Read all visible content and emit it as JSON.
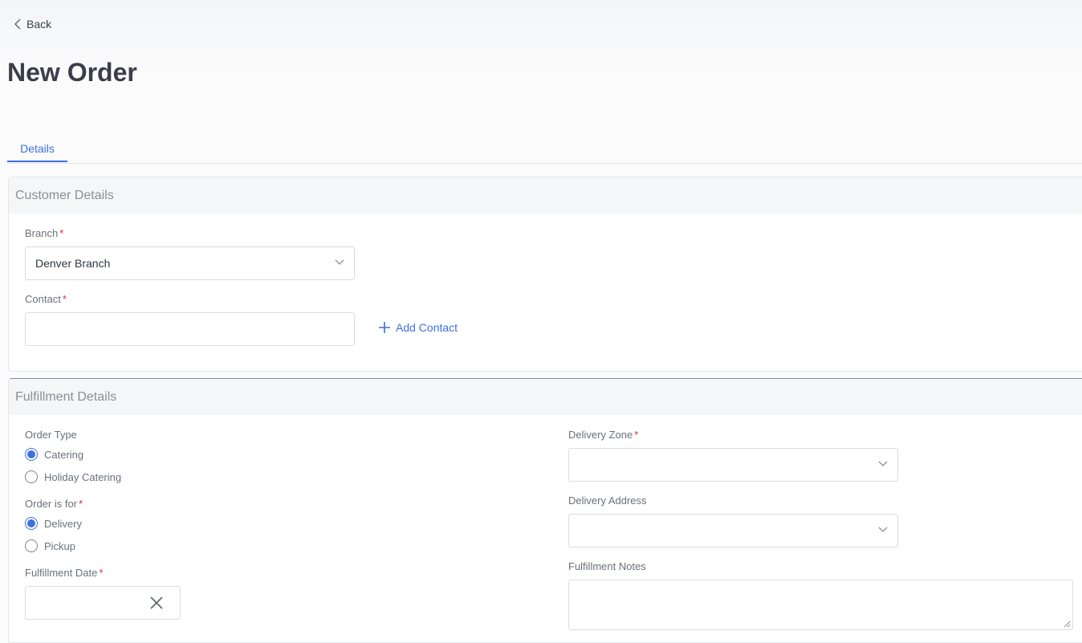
{
  "header": {
    "back_label": "Back",
    "page_title": "New Order"
  },
  "tabs": [
    {
      "label": "Details",
      "active": true
    }
  ],
  "customer_details": {
    "section_title": "Customer Details",
    "branch": {
      "label": "Branch",
      "value": "Denver Branch"
    },
    "contact": {
      "label": "Contact",
      "value": "",
      "add_label": "Add Contact"
    }
  },
  "fulfillment_details": {
    "section_title": "Fulfillment Details",
    "order_type": {
      "label": "Order Type",
      "options": [
        {
          "label": "Catering",
          "checked": true
        },
        {
          "label": "Holiday Catering",
          "checked": false
        }
      ]
    },
    "order_is_for": {
      "label": "Order is for",
      "options": [
        {
          "label": "Delivery",
          "checked": true
        },
        {
          "label": "Pickup",
          "checked": false
        }
      ]
    },
    "fulfillment_date": {
      "label": "Fulfillment Date",
      "value": ""
    },
    "delivery_zone": {
      "label": "Delivery Zone",
      "value": ""
    },
    "delivery_address": {
      "label": "Delivery Address",
      "value": ""
    },
    "fulfillment_notes": {
      "label": "Fulfillment Notes",
      "value": ""
    }
  },
  "required_marker": "*",
  "colors": {
    "accent": "#3f6fe0",
    "required": "#d93025",
    "title": "#3b3e4a"
  },
  "icons": {
    "back": "chevron-left-icon",
    "dropdown": "chevron-down-icon",
    "add": "plus-icon",
    "clear": "close-icon"
  }
}
